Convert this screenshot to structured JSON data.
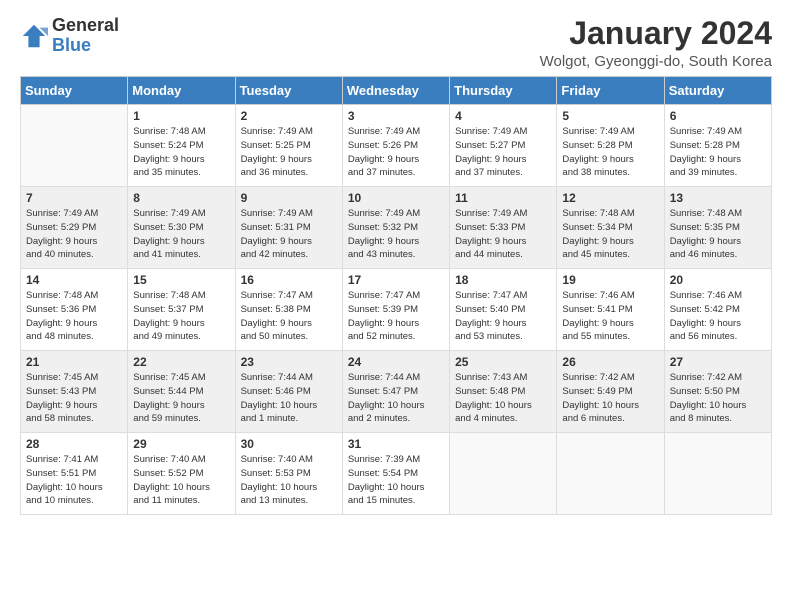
{
  "logo": {
    "general": "General",
    "blue": "Blue"
  },
  "header": {
    "title": "January 2024",
    "location": "Wolgot, Gyeonggi-do, South Korea"
  },
  "weekdays": [
    "Sunday",
    "Monday",
    "Tuesday",
    "Wednesday",
    "Thursday",
    "Friday",
    "Saturday"
  ],
  "weeks": [
    [
      {
        "day": "",
        "info": ""
      },
      {
        "day": "1",
        "info": "Sunrise: 7:48 AM\nSunset: 5:24 PM\nDaylight: 9 hours\nand 35 minutes."
      },
      {
        "day": "2",
        "info": "Sunrise: 7:49 AM\nSunset: 5:25 PM\nDaylight: 9 hours\nand 36 minutes."
      },
      {
        "day": "3",
        "info": "Sunrise: 7:49 AM\nSunset: 5:26 PM\nDaylight: 9 hours\nand 37 minutes."
      },
      {
        "day": "4",
        "info": "Sunrise: 7:49 AM\nSunset: 5:27 PM\nDaylight: 9 hours\nand 37 minutes."
      },
      {
        "day": "5",
        "info": "Sunrise: 7:49 AM\nSunset: 5:28 PM\nDaylight: 9 hours\nand 38 minutes."
      },
      {
        "day": "6",
        "info": "Sunrise: 7:49 AM\nSunset: 5:28 PM\nDaylight: 9 hours\nand 39 minutes."
      }
    ],
    [
      {
        "day": "7",
        "info": ""
      },
      {
        "day": "8",
        "info": "Sunrise: 7:49 AM\nSunset: 5:30 PM\nDaylight: 9 hours\nand 41 minutes."
      },
      {
        "day": "9",
        "info": "Sunrise: 7:49 AM\nSunset: 5:31 PM\nDaylight: 9 hours\nand 42 minutes."
      },
      {
        "day": "10",
        "info": "Sunrise: 7:49 AM\nSunset: 5:32 PM\nDaylight: 9 hours\nand 43 minutes."
      },
      {
        "day": "11",
        "info": "Sunrise: 7:49 AM\nSunset: 5:33 PM\nDaylight: 9 hours\nand 44 minutes."
      },
      {
        "day": "12",
        "info": "Sunrise: 7:48 AM\nSunset: 5:34 PM\nDaylight: 9 hours\nand 45 minutes."
      },
      {
        "day": "13",
        "info": "Sunrise: 7:48 AM\nSunset: 5:35 PM\nDaylight: 9 hours\nand 46 minutes."
      }
    ],
    [
      {
        "day": "14",
        "info": ""
      },
      {
        "day": "15",
        "info": "Sunrise: 7:48 AM\nSunset: 5:37 PM\nDaylight: 9 hours\nand 49 minutes."
      },
      {
        "day": "16",
        "info": "Sunrise: 7:47 AM\nSunset: 5:38 PM\nDaylight: 9 hours\nand 50 minutes."
      },
      {
        "day": "17",
        "info": "Sunrise: 7:47 AM\nSunset: 5:39 PM\nDaylight: 9 hours\nand 52 minutes."
      },
      {
        "day": "18",
        "info": "Sunrise: 7:47 AM\nSunset: 5:40 PM\nDaylight: 9 hours\nand 53 minutes."
      },
      {
        "day": "19",
        "info": "Sunrise: 7:46 AM\nSunset: 5:41 PM\nDaylight: 9 hours\nand 55 minutes."
      },
      {
        "day": "20",
        "info": "Sunrise: 7:46 AM\nSunset: 5:42 PM\nDaylight: 9 hours\nand 56 minutes."
      }
    ],
    [
      {
        "day": "21",
        "info": ""
      },
      {
        "day": "22",
        "info": "Sunrise: 7:45 AM\nSunset: 5:44 PM\nDaylight: 9 hours\nand 59 minutes."
      },
      {
        "day": "23",
        "info": "Sunrise: 7:44 AM\nSunset: 5:46 PM\nDaylight: 10 hours\nand 1 minute."
      },
      {
        "day": "24",
        "info": "Sunrise: 7:44 AM\nSunset: 5:47 PM\nDaylight: 10 hours\nand 2 minutes."
      },
      {
        "day": "25",
        "info": "Sunrise: 7:43 AM\nSunset: 5:48 PM\nDaylight: 10 hours\nand 4 minutes."
      },
      {
        "day": "26",
        "info": "Sunrise: 7:42 AM\nSunset: 5:49 PM\nDaylight: 10 hours\nand 6 minutes."
      },
      {
        "day": "27",
        "info": "Sunrise: 7:42 AM\nSunset: 5:50 PM\nDaylight: 10 hours\nand 8 minutes."
      }
    ],
    [
      {
        "day": "28",
        "info": ""
      },
      {
        "day": "29",
        "info": "Sunrise: 7:40 AM\nSunset: 5:52 PM\nDaylight: 10 hours\nand 11 minutes."
      },
      {
        "day": "30",
        "info": "Sunrise: 7:40 AM\nSunset: 5:53 PM\nDaylight: 10 hours\nand 13 minutes."
      },
      {
        "day": "31",
        "info": "Sunrise: 7:39 AM\nSunset: 5:54 PM\nDaylight: 10 hours\nand 15 minutes."
      },
      {
        "day": "",
        "info": ""
      },
      {
        "day": "",
        "info": ""
      },
      {
        "day": "",
        "info": ""
      }
    ]
  ],
  "week1_sun_info": "Sunrise: 7:49 AM\nSunset: 5:29 PM\nDaylight: 9 hours\nand 40 minutes.",
  "week3_sun_info": "Sunrise: 7:48 AM\nSunset: 5:36 PM\nDaylight: 9 hours\nand 48 minutes.",
  "week4_sun_info": "Sunrise: 7:45 AM\nSunset: 5:43 PM\nDaylight: 9 hours\nand 58 minutes.",
  "week5_sun_info": "Sunrise: 7:41 AM\nSunset: 5:51 PM\nDaylight: 10 hours\nand 10 minutes."
}
